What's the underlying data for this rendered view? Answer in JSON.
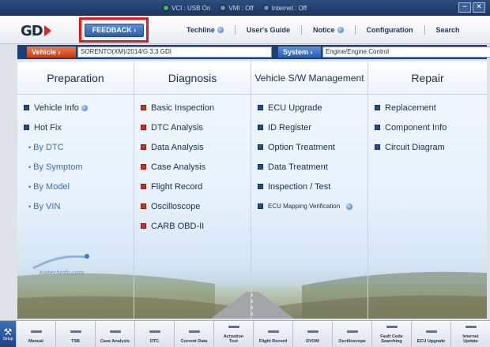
{
  "titlebar": {
    "status": [
      {
        "label": "VCI : USB On",
        "color": "#36c23b",
        "icon": "vci-status-icon"
      },
      {
        "label": "VMI : Off",
        "color": "#7b8ea8",
        "icon": "vmi-status-icon"
      },
      {
        "label": "Internet : Off",
        "color": "#7b8ea8",
        "icon": "internet-status-icon"
      }
    ],
    "minimize_symbol": "−",
    "close_symbol": "✕"
  },
  "header": {
    "logo_text": "GD",
    "feedback_label": "FEEDBACK ›",
    "nav": {
      "techline": "Techline",
      "users_guide": "User's Guide",
      "notice": "Notice",
      "configuration": "Configuration",
      "search": "Search"
    }
  },
  "vehicle_bar": {
    "vehicle_label": "Vehicle ›",
    "vehicle_value": "SORENTO(XM)/2014/G 3.3 GDI",
    "system_label": "System ›",
    "system_value": "Engine/Engine Control"
  },
  "columns": {
    "preparation": {
      "title": "Preparation",
      "items": [
        "Vehicle Info",
        "Hot Fix"
      ],
      "sub_items": [
        "By DTC",
        "By Symptom",
        "By Model",
        "By VIN"
      ]
    },
    "diagnosis": {
      "title": "Diagnosis",
      "items": [
        "Basic Inspection",
        "DTC Analysis",
        "Data Analysis",
        "Case Analysis",
        "Flight Record",
        "Oscilloscope",
        "CARB OBD-II"
      ]
    },
    "vehicle_sw": {
      "title": "Vehicle S/W Management",
      "items": [
        "ECU Upgrade",
        "ID Register",
        "Option Treatment",
        "Data Treatment",
        "Inspection / Test",
        "ECU Mapping Verification"
      ]
    },
    "repair": {
      "title": "Repair",
      "items": [
        "Replacement",
        "Component Info",
        "Circuit Diagram"
      ]
    }
  },
  "watermark_text": "kiatechinfo.com",
  "toolbar": {
    "setup_label": "Setup",
    "items": [
      "Manual",
      "TSB",
      "Case Analysis",
      "DTC",
      "Current Data",
      "Actuation\nTest",
      "Flight Record",
      "DVOM",
      "Oscilloscope",
      "Fault Code\nSearching",
      "ECU Upgrade",
      "Internet\nUpdate"
    ]
  },
  "colors": {
    "accent_blue": "#1c3f78",
    "highlight_red": "#e01919",
    "bullet_blue": "#1f4e93",
    "bullet_red": "#c83424"
  }
}
